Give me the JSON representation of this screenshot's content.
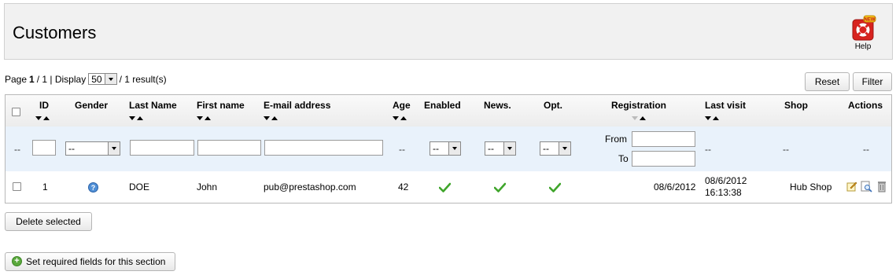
{
  "page": {
    "title": "Customers",
    "help_label": "Help",
    "help_badge": "NEW"
  },
  "pager": {
    "page_prefix": "Page",
    "page_current": "1",
    "page_total": "/ 1 | Display",
    "per_page": "50",
    "results": "/ 1 result(s)"
  },
  "actions": {
    "reset_label": "Reset",
    "filter_label": "Filter",
    "delete_label": "Delete selected",
    "required_label": "Set required fields for this section"
  },
  "columns": {
    "id": "ID",
    "gender": "Gender",
    "last_name": "Last Name",
    "first_name": "First name",
    "email": "E-mail address",
    "age": "Age",
    "enabled": "Enabled",
    "news": "News.",
    "opt": "Opt.",
    "registration": "Registration",
    "last_visit": "Last visit",
    "shop": "Shop",
    "actions": "Actions"
  },
  "filters": {
    "dash": "--",
    "gender_value": "--",
    "enabled_value": "--",
    "news_value": "--",
    "opt_value": "--",
    "from_label": "From",
    "to_label": "To"
  },
  "row": {
    "id": "1",
    "gender_icon": "question-icon",
    "last_name": "DOE",
    "first_name": "John",
    "email": "pub@prestashop.com",
    "age": "42",
    "enabled": true,
    "news": true,
    "opt": true,
    "registration": "08/6/2012",
    "last_visit_date": "08/6/2012",
    "last_visit_time": "16:13:38",
    "shop": "Hub Shop"
  },
  "colors": {
    "check_green": "#3fa52b",
    "filter_row_bg": "#e9f2fb",
    "header_bg": "#f1f1f1"
  }
}
